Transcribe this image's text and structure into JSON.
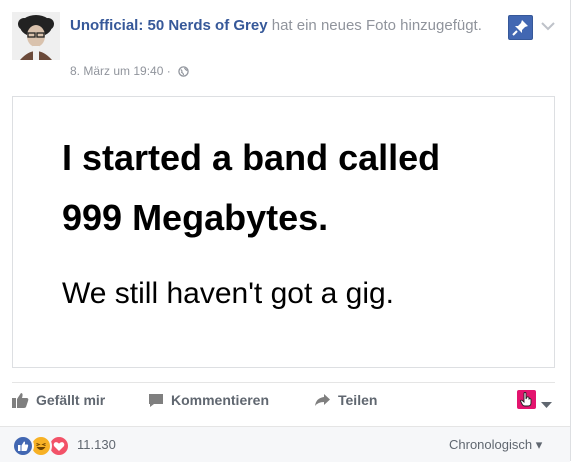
{
  "post": {
    "page_name": "Unofficial: 50 Nerds of Grey",
    "action_text": "hat ein neues Foto hinzugefügt.",
    "timestamp": "8. März um 19:40",
    "separator": "·"
  },
  "photo": {
    "line1": "I started a band called",
    "line2": "999 Megabytes.",
    "line3": "We still haven't got a gig."
  },
  "actions": {
    "like": "Gefällt mir",
    "comment": "Kommentieren",
    "share": "Teilen"
  },
  "footer": {
    "reaction_count": "11.130",
    "sort_label": "Chronologisch",
    "sort_caret": "▾"
  },
  "colors": {
    "link": "#365899",
    "pin_button": "#4267b2",
    "audience_button": "#e3146e",
    "like_reaction": "#4267b2",
    "haha_reaction": "#f7b125",
    "love_reaction": "#f25268"
  },
  "icons": {
    "avatar": "profile-photo",
    "globe": "globe-icon",
    "pin": "pin-icon",
    "menu": "chevron-down-icon",
    "like": "thumbs-up-icon",
    "comment": "speech-bubble-icon",
    "share": "share-arrow-icon",
    "audience": "hand-cursor-icon"
  }
}
